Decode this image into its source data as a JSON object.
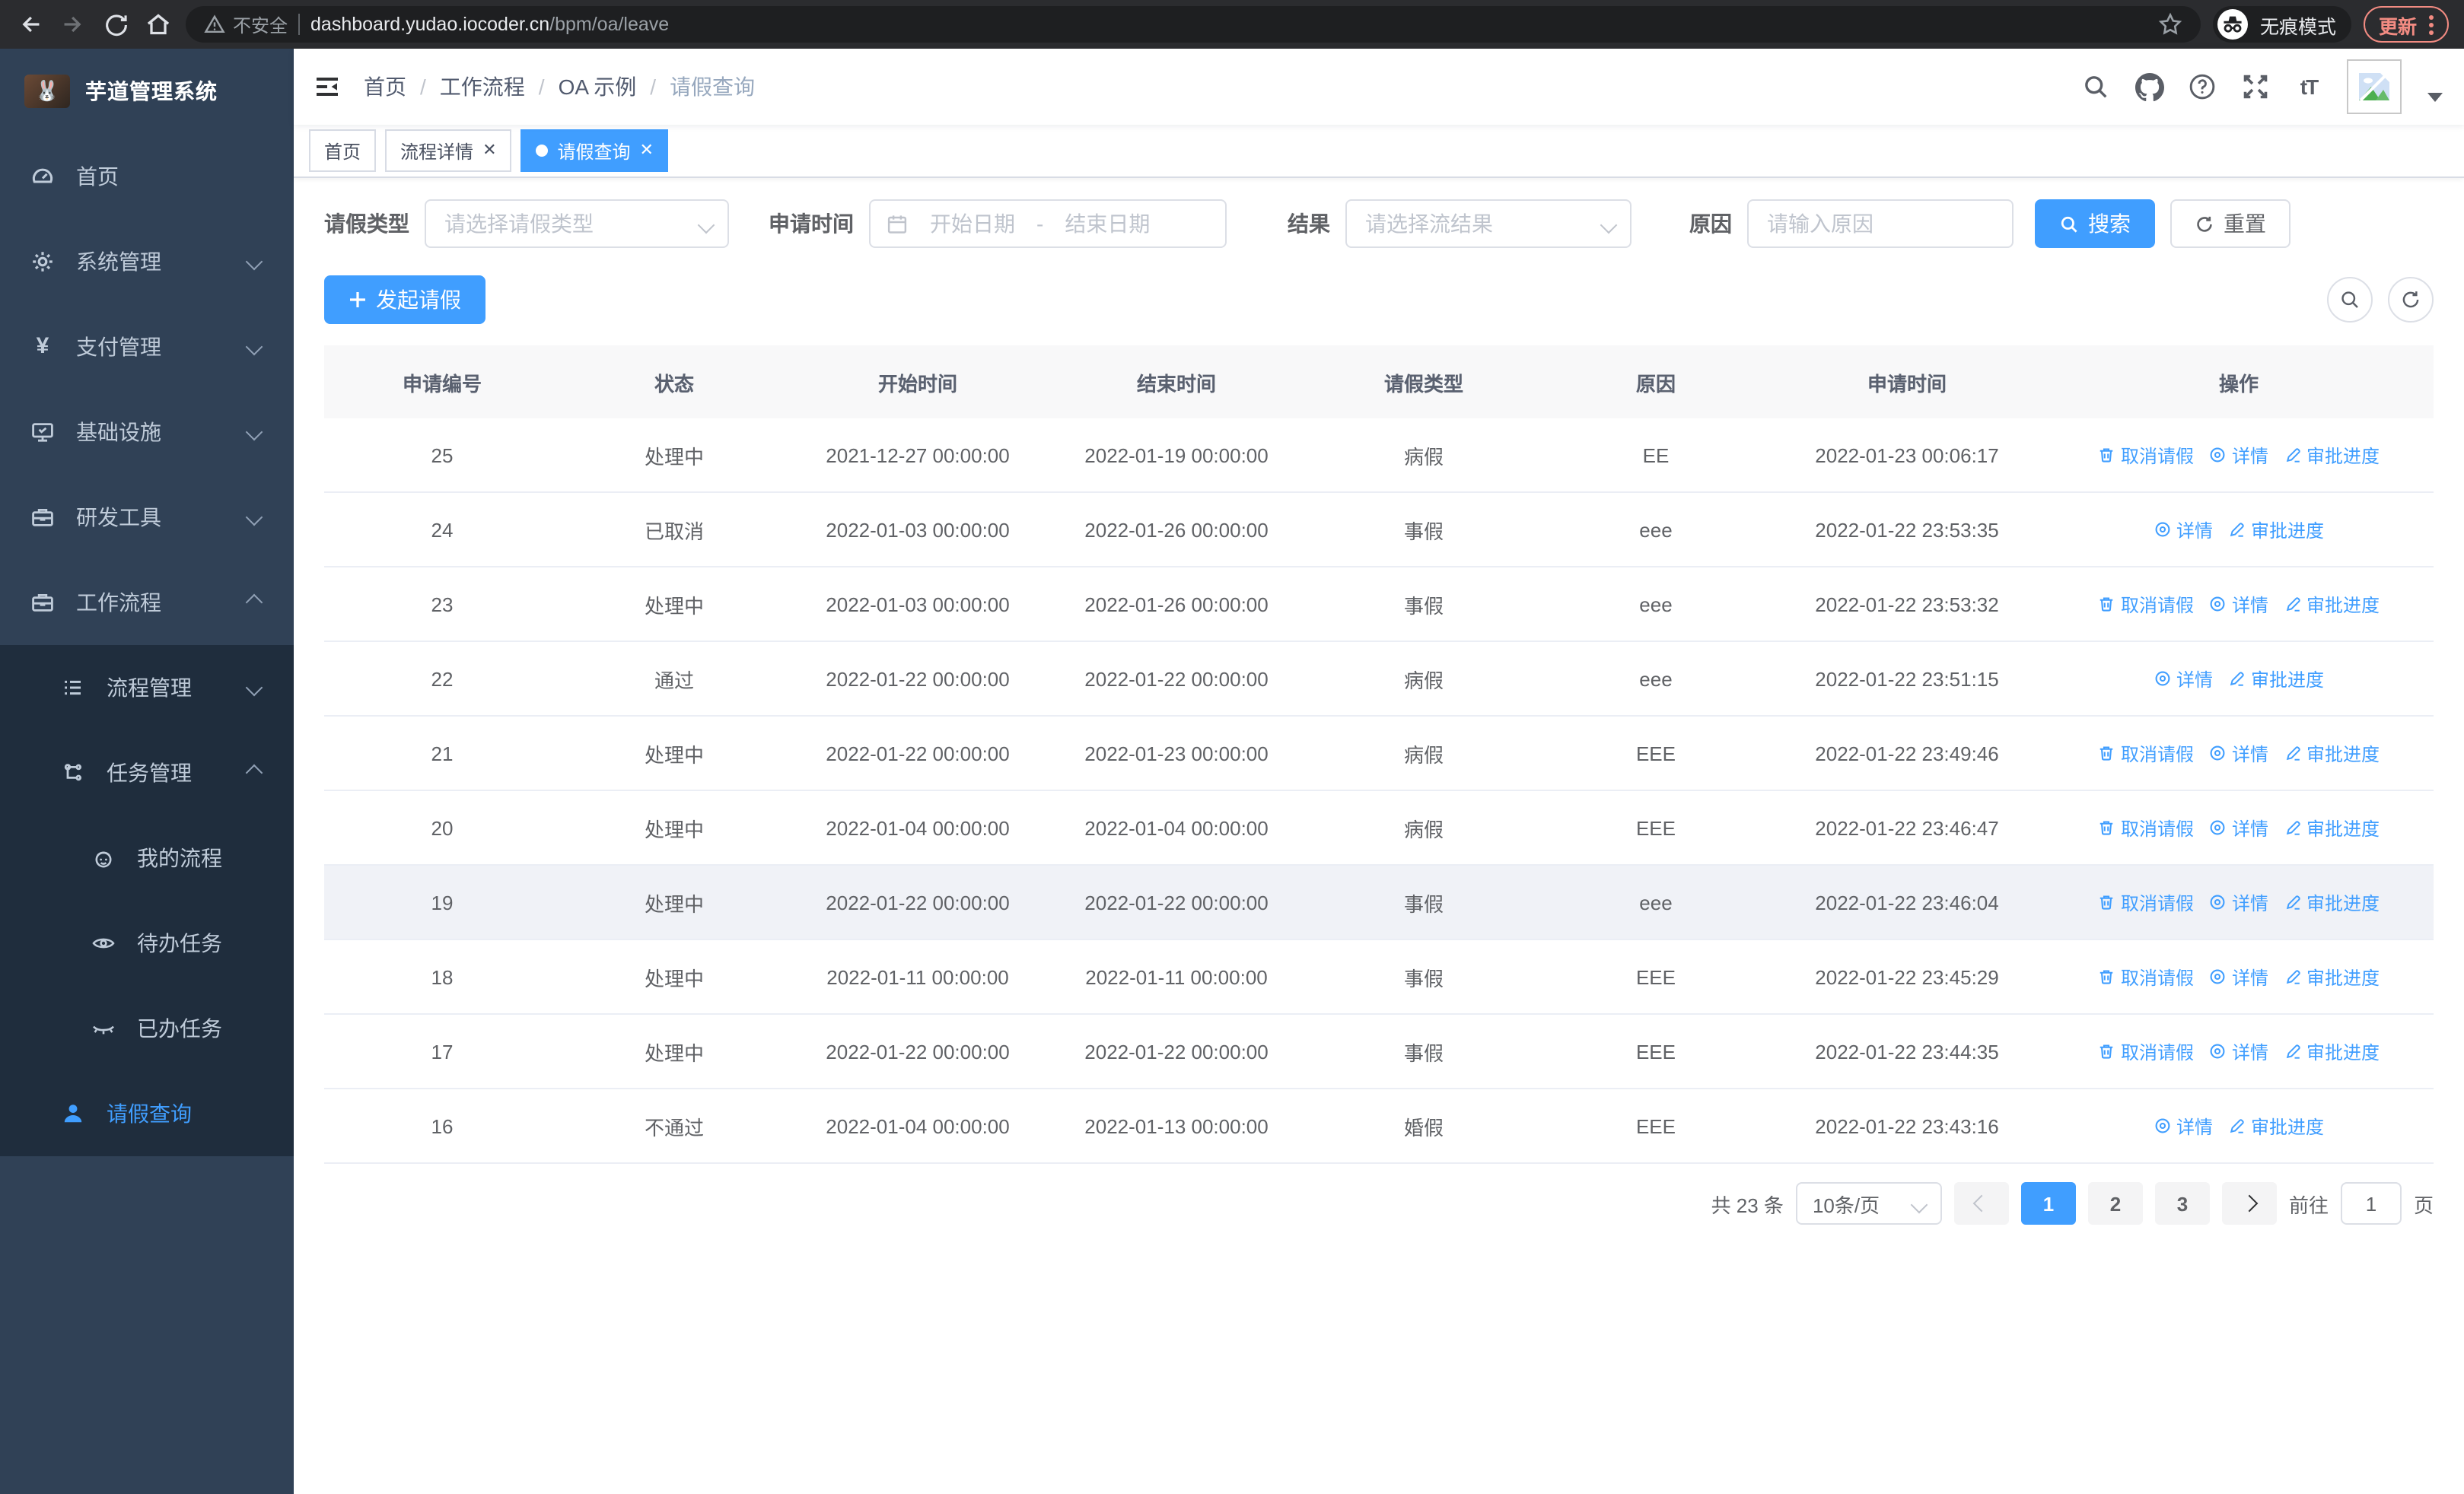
{
  "browser": {
    "security_label": "不安全",
    "url_host": "dashboard.yudao.iocoder.cn",
    "url_path": "/bpm/oa/leave",
    "incognito_label": "无痕模式",
    "update_label": "更新"
  },
  "sidebar": {
    "title": "芋道管理系统",
    "logo_char": "🐰",
    "items": [
      {
        "label": "首页"
      },
      {
        "label": "系统管理"
      },
      {
        "label": "支付管理"
      },
      {
        "label": "基础设施"
      },
      {
        "label": "研发工具"
      },
      {
        "label": "工作流程"
      },
      {
        "label": "流程管理"
      },
      {
        "label": "任务管理"
      },
      {
        "label": "我的流程"
      },
      {
        "label": "待办任务"
      },
      {
        "label": "已办任务"
      },
      {
        "label": "请假查询"
      }
    ]
  },
  "breadcrumb": {
    "separator": "/",
    "items": [
      "首页",
      "工作流程",
      "OA 示例",
      "请假查询"
    ]
  },
  "tabs": [
    {
      "label": "首页"
    },
    {
      "label": "流程详情"
    },
    {
      "label": "请假查询"
    }
  ],
  "filters": {
    "leave_type_label": "请假类型",
    "leave_type_placeholder": "请选择请假类型",
    "apply_time_label": "申请时间",
    "date_start_placeholder": "开始日期",
    "date_separator": "-",
    "date_end_placeholder": "结束日期",
    "result_label": "结果",
    "result_placeholder": "请选择流结果",
    "reason_label": "原因",
    "reason_placeholder": "请输入原因",
    "search_label": "搜索",
    "reset_label": "重置"
  },
  "toolbar": {
    "create_label": "发起请假"
  },
  "table": {
    "headers": [
      "申请编号",
      "状态",
      "开始时间",
      "结束时间",
      "请假类型",
      "原因",
      "申请时间",
      "操作"
    ],
    "action_labels": {
      "cancel": "取消请假",
      "detail": "详情",
      "progress": "审批进度"
    },
    "rows": [
      {
        "id": "25",
        "status": "处理中",
        "start": "2021-12-27 00:00:00",
        "end": "2022-01-19 00:00:00",
        "type": "病假",
        "reason": "EE",
        "apply_time": "2022-01-23 00:06:17",
        "actions": [
          "cancel",
          "detail",
          "progress"
        ],
        "highlight": false
      },
      {
        "id": "24",
        "status": "已取消",
        "start": "2022-01-03 00:00:00",
        "end": "2022-01-26 00:00:00",
        "type": "事假",
        "reason": "eee",
        "apply_time": "2022-01-22 23:53:35",
        "actions": [
          "detail",
          "progress"
        ],
        "highlight": false
      },
      {
        "id": "23",
        "status": "处理中",
        "start": "2022-01-03 00:00:00",
        "end": "2022-01-26 00:00:00",
        "type": "事假",
        "reason": "eee",
        "apply_time": "2022-01-22 23:53:32",
        "actions": [
          "cancel",
          "detail",
          "progress"
        ],
        "highlight": false
      },
      {
        "id": "22",
        "status": "通过",
        "start": "2022-01-22 00:00:00",
        "end": "2022-01-22 00:00:00",
        "type": "病假",
        "reason": "eee",
        "apply_time": "2022-01-22 23:51:15",
        "actions": [
          "detail",
          "progress"
        ],
        "highlight": false
      },
      {
        "id": "21",
        "status": "处理中",
        "start": "2022-01-22 00:00:00",
        "end": "2022-01-23 00:00:00",
        "type": "病假",
        "reason": "EEE",
        "apply_time": "2022-01-22 23:49:46",
        "actions": [
          "cancel",
          "detail",
          "progress"
        ],
        "highlight": false
      },
      {
        "id": "20",
        "status": "处理中",
        "start": "2022-01-04 00:00:00",
        "end": "2022-01-04 00:00:00",
        "type": "病假",
        "reason": "EEE",
        "apply_time": "2022-01-22 23:46:47",
        "actions": [
          "cancel",
          "detail",
          "progress"
        ],
        "highlight": false
      },
      {
        "id": "19",
        "status": "处理中",
        "start": "2022-01-22 00:00:00",
        "end": "2022-01-22 00:00:00",
        "type": "事假",
        "reason": "eee",
        "apply_time": "2022-01-22 23:46:04",
        "actions": [
          "cancel",
          "detail",
          "progress"
        ],
        "highlight": true
      },
      {
        "id": "18",
        "status": "处理中",
        "start": "2022-01-11 00:00:00",
        "end": "2022-01-11 00:00:00",
        "type": "事假",
        "reason": "EEE",
        "apply_time": "2022-01-22 23:45:29",
        "actions": [
          "cancel",
          "detail",
          "progress"
        ],
        "highlight": false
      },
      {
        "id": "17",
        "status": "处理中",
        "start": "2022-01-22 00:00:00",
        "end": "2022-01-22 00:00:00",
        "type": "事假",
        "reason": "EEE",
        "apply_time": "2022-01-22 23:44:35",
        "actions": [
          "cancel",
          "detail",
          "progress"
        ],
        "highlight": false
      },
      {
        "id": "16",
        "status": "不通过",
        "start": "2022-01-04 00:00:00",
        "end": "2022-01-13 00:00:00",
        "type": "婚假",
        "reason": "EEE",
        "apply_time": "2022-01-22 23:43:16",
        "actions": [
          "detail",
          "progress"
        ],
        "highlight": false
      }
    ]
  },
  "pagination": {
    "total_label": "共 23 条",
    "page_size_label": "10条/页",
    "pages": [
      "1",
      "2",
      "3"
    ],
    "active_page": "1",
    "goto_label": "前往",
    "goto_value": "1",
    "page_unit_label": "页"
  },
  "colors": {
    "accent": "#409eff",
    "sidebar_bg": "#304156",
    "submenu_bg": "#1f2d3d",
    "update_accent": "#f28b82",
    "highlight_row": "#f0f2f7"
  }
}
